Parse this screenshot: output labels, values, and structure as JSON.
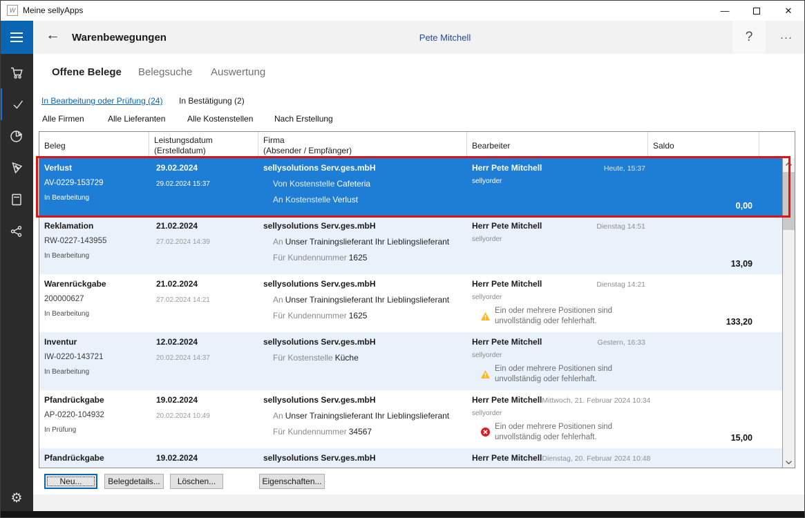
{
  "colors": {
    "accent_blue": "#0a66b2",
    "selection_blue": "#1e7ed5",
    "highlight_red": "#de1414",
    "zebra_blue": "#e9f1fb",
    "link_blue": "#0b63b8",
    "user_blue": "#24489a",
    "warning_yellow": "#fdb913",
    "error_red": "#e11b22",
    "sidebar_bg": "#2b2b2b"
  },
  "window": {
    "title": "Meine sellyApps",
    "app_icon": "W",
    "minimize": "—",
    "close": "✕"
  },
  "sidebar": {
    "icons": [
      "menu",
      "cart",
      "check",
      "pie-chart",
      "tag",
      "book",
      "share",
      "settings"
    ],
    "active": "check",
    "settings_glyph": "⚙"
  },
  "header": {
    "back": "←",
    "title": "Warenbewegungen",
    "user": "Pete Mitchell",
    "help": "?",
    "more": "···"
  },
  "tabs": [
    {
      "label": "Offene Belege",
      "active": true
    },
    {
      "label": "Belegsuche",
      "active": false
    },
    {
      "label": "Auswertung",
      "active": false
    }
  ],
  "filters": {
    "links": [
      {
        "label": "In Bearbeitung oder Prüfung (24)",
        "active": true
      },
      {
        "label": "In Bestätigung (2)",
        "active": false
      }
    ],
    "dropdowns": [
      "Alle Firmen",
      "Alle Lieferanten",
      "Alle Kostenstellen",
      "Nach Erstellung"
    ]
  },
  "table": {
    "columns": [
      {
        "line1": "Beleg",
        "line2": ""
      },
      {
        "line1": "Leistungsdatum",
        "line2": "(Erstelldatum)"
      },
      {
        "line1": "Firma",
        "line2": "(Absender / Empfänger)"
      },
      {
        "line1": "Bearbeiter",
        "line2": ""
      },
      {
        "line1": "Saldo",
        "line2": ""
      }
    ],
    "rows": [
      {
        "type": "Verlust",
        "number": "AV-0229-153729",
        "status": "In Bearbeitung",
        "date": "29.02.2024",
        "created": "29.02.2024 15:37",
        "company": "sellysolutions Serv.ges.mbH",
        "detail1_prefix": "Von Kostenstelle",
        "detail1_value": "Cafeteria",
        "detail2_prefix": "An Kostenstelle",
        "detail2_value": "Verlust",
        "editor": "Herr Pete Mitchell",
        "edited": "Heute, 15:37",
        "source": "sellyorder",
        "saldo": "0,00",
        "selected": true
      },
      {
        "type": "Reklamation",
        "number": "RW-0227-143955",
        "status": "In Bearbeitung",
        "date": "21.02.2024",
        "created": "27.02.2024 14:39",
        "company": "sellysolutions Serv.ges.mbH",
        "detail1_prefix": "An",
        "detail1_value": "Unser Trainingslieferant Ihr Lieblingslieferant",
        "detail2_prefix": "Für Kundennummer",
        "detail2_value": "1625",
        "editor": "Herr Pete Mitchell",
        "edited": "Dienstag 14:51",
        "source": "sellyorder",
        "saldo": "13,09",
        "selected": false
      },
      {
        "type": "Warenrückgabe",
        "number": "200000627",
        "status": "In Bearbeitung",
        "date": "21.02.2024",
        "created": "27.02.2024 14:21",
        "company": "sellysolutions Serv.ges.mbH",
        "detail1_prefix": "An",
        "detail1_value": "Unser Trainingslieferant Ihr Lieblingslieferant",
        "detail2_prefix": "Für Kundennummer",
        "detail2_value": "1625",
        "editor": "Herr Pete Mitchell",
        "edited": "Dienstag 14:21",
        "source": "sellyorder",
        "alert": "Ein oder mehrere Positionen sind unvollständig oder fehlerhaft.",
        "alert_kind": "warning",
        "saldo": "133,20",
        "selected": false
      },
      {
        "type": "Inventur",
        "number": "IW-0220-143721",
        "status": "In Bearbeitung",
        "date": "12.02.2024",
        "created": "20.02.2024 14:37",
        "company": "sellysolutions Serv.ges.mbH",
        "detail1_prefix": "Für Kostenstelle",
        "detail1_value": "Küche",
        "editor": "Herr Pete Mitchell",
        "edited": "Gestern, 16:33",
        "source": "sellyorder",
        "alert": "Ein oder mehrere Positionen sind unvollständig oder fehlerhaft.",
        "alert_kind": "warning",
        "saldo": "",
        "selected": false
      },
      {
        "type": "Pfandrückgabe",
        "number": "AP-0220-104932",
        "status": "In Prüfung",
        "date": "19.02.2024",
        "created": "20.02.2024 10:49",
        "company": "sellysolutions Serv.ges.mbH",
        "detail1_prefix": "An",
        "detail1_value": "Unser Trainingslieferant Ihr Lieblingslieferant",
        "detail2_prefix": "Für Kundennummer",
        "detail2_value": "34567",
        "editor": "Herr Pete Mitchell",
        "edited": "Mittwoch, 21. Februar 2024 10:34",
        "source": "sellyorder",
        "alert": "Ein oder mehrere Positionen sind unvollständig oder fehlerhaft.",
        "alert_kind": "error",
        "saldo": "15,00",
        "selected": false
      },
      {
        "type": "Pfandrückgabe",
        "date": "19.02.2024",
        "company": "sellysolutions Serv.ges.mbH",
        "editor": "Herr Pete Mitchell",
        "edited": "Dienstag, 20. Februar 2024 10:48"
      }
    ]
  },
  "footer": {
    "buttons": [
      {
        "label": "Neu...",
        "focused": true
      },
      {
        "label": "Belegdetails...",
        "focused": false
      },
      {
        "label": "Löschen...",
        "focused": false
      },
      {
        "label": "Eigenschaften...",
        "focused": false
      }
    ]
  }
}
